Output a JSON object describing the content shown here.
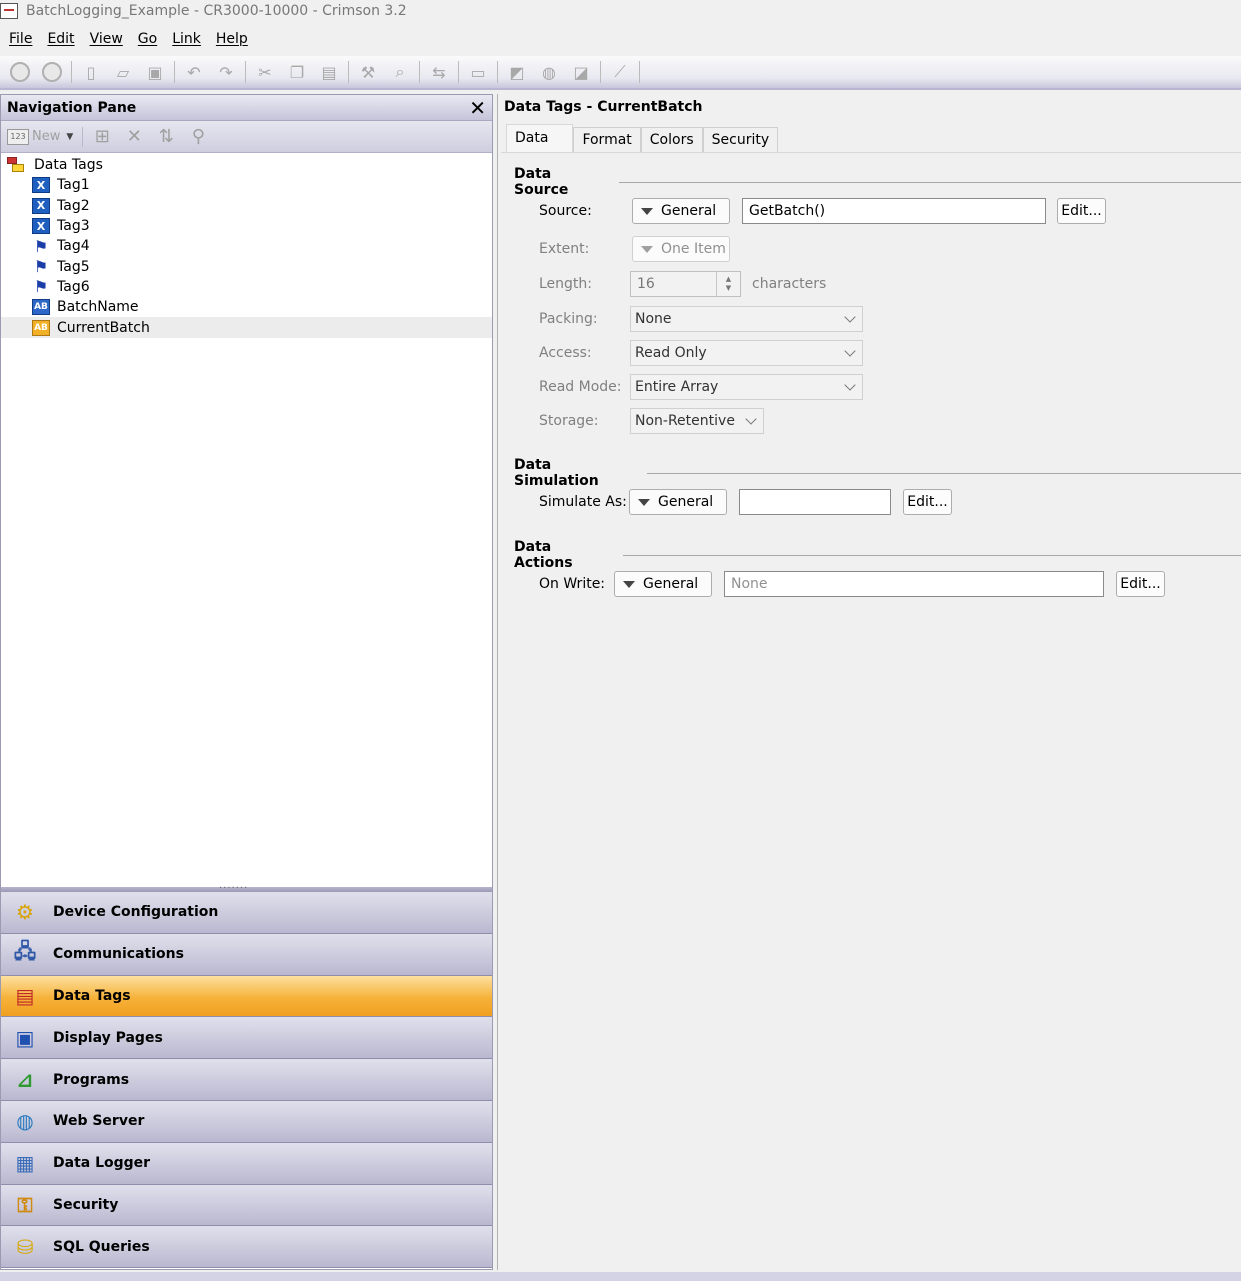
{
  "window": {
    "title": "BatchLogging_Example - CR3000-10000 - Crimson 3.2"
  },
  "menu": [
    "File",
    "Edit",
    "View",
    "Go",
    "Link",
    "Help"
  ],
  "nav": {
    "header": "Navigation Pane",
    "new_label": "New",
    "new_icon_text": "123",
    "tree": {
      "root": "Data Tags",
      "items": [
        {
          "label": "Tag1",
          "icon": "numeric-tag-icon"
        },
        {
          "label": "Tag2",
          "icon": "numeric-tag-icon"
        },
        {
          "label": "Tag3",
          "icon": "numeric-tag-icon"
        },
        {
          "label": "Tag4",
          "icon": "flag-tag-icon"
        },
        {
          "label": "Tag5",
          "icon": "flag-tag-icon"
        },
        {
          "label": "Tag6",
          "icon": "flag-tag-icon"
        },
        {
          "label": "BatchName",
          "icon": "string-tag-icon"
        },
        {
          "label": "CurrentBatch",
          "icon": "string-tag-icon"
        }
      ],
      "selected": "CurrentBatch"
    },
    "categories": [
      {
        "label": "Device Configuration",
        "icon": "gear-icon"
      },
      {
        "label": "Communications",
        "icon": "network-icon"
      },
      {
        "label": "Data Tags",
        "icon": "tags-icon"
      },
      {
        "label": "Display Pages",
        "icon": "display-icon"
      },
      {
        "label": "Programs",
        "icon": "flowchart-icon"
      },
      {
        "label": "Web Server",
        "icon": "globe-icon"
      },
      {
        "label": "Data Logger",
        "icon": "chart-icon"
      },
      {
        "label": "Security",
        "icon": "key-icon"
      },
      {
        "label": "SQL Queries",
        "icon": "database-icon"
      }
    ],
    "active_category": "Data Tags"
  },
  "editor": {
    "header": "Data Tags - CurrentBatch",
    "tabs": [
      "Data",
      "Format",
      "Colors",
      "Security"
    ],
    "active_tab": "Data",
    "data_source": {
      "title": "Data Source",
      "source_label": "Source:",
      "source_mode": "General",
      "source_value": "GetBatch()",
      "edit_label": "Edit...",
      "extent_label": "Extent:",
      "extent_value": "One Item",
      "length_label": "Length:",
      "length_value": "16",
      "length_suffix": "characters",
      "packing_label": "Packing:",
      "packing_value": "None",
      "access_label": "Access:",
      "access_value": "Read Only",
      "readmode_label": "Read Mode:",
      "readmode_value": "Entire Array",
      "storage_label": "Storage:",
      "storage_value": "Non-Retentive"
    },
    "data_simulation": {
      "title": "Data Simulation",
      "simulate_label": "Simulate As:",
      "simulate_mode": "General",
      "simulate_value": "",
      "edit_label": "Edit..."
    },
    "data_actions": {
      "title": "Data Actions",
      "onwrite_label": "On Write:",
      "onwrite_mode": "General",
      "onwrite_placeholder": "None",
      "edit_label": "Edit..."
    }
  }
}
